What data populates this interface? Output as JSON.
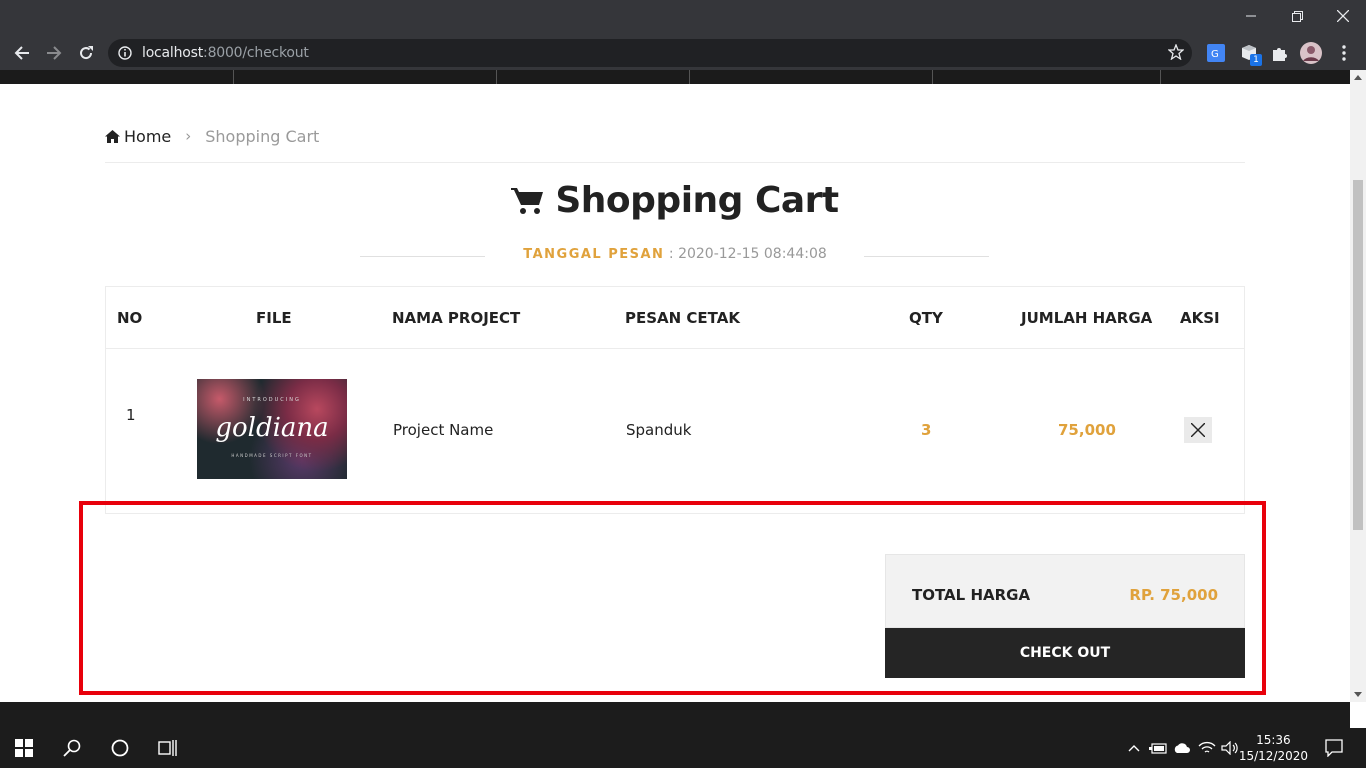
{
  "browser": {
    "url_host": "localhost",
    "url_rest": ":8000/checkout",
    "extension_badge": "1"
  },
  "breadcrumb": {
    "home": "Home",
    "current": "Shopping Cart"
  },
  "page": {
    "title": "Shopping Cart",
    "date_label": "TANGGAL PESAN",
    "date_value": ": 2020-12-15 08:44:08"
  },
  "table": {
    "headers": {
      "no": "NO",
      "file": "FILE",
      "project": "NAMA PROJECT",
      "print": "PESAN CETAK",
      "qty": "QTY",
      "price": "JUMLAH HARGA",
      "action": "AKSI"
    },
    "rows": [
      {
        "no": "1",
        "thumb_intro": "INTRODUCING",
        "thumb_title": "goldiana",
        "thumb_sub": "HANDMADE SCRIPT FONT",
        "project": "Project Name",
        "print": "Spanduk",
        "qty": "3",
        "price": "75,000"
      }
    ]
  },
  "summary": {
    "total_label": "TOTAL HARGA",
    "total_value": "RP. 75,000",
    "checkout": "CHECK OUT"
  },
  "taskbar": {
    "time": "15:36",
    "date": "15/12/2020"
  },
  "colors": {
    "accent": "#e0a23c",
    "highlight": "#e8000b",
    "dark": "#252525"
  }
}
